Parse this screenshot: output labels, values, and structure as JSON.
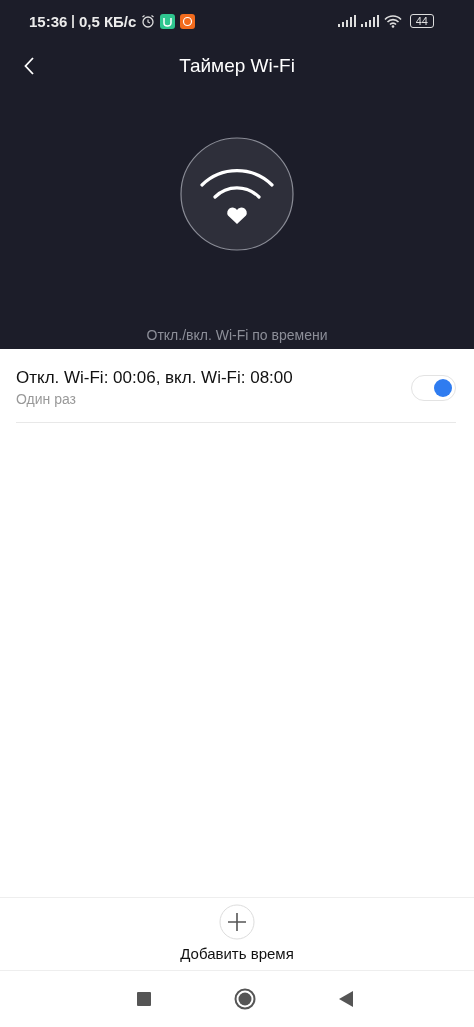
{
  "status_bar": {
    "time": "15:36",
    "speed": "0,5 КБ/с",
    "battery": "44"
  },
  "header": {
    "title": "Таймер Wi-Fi",
    "subtitle": "Откл./вкл. Wi-Fi по времени"
  },
  "timers": [
    {
      "title": "Откл. Wi-Fi: 00:06, вкл. Wi-Fi: 08:00",
      "repeat": "Один раз",
      "on": true
    }
  ],
  "add_button": {
    "label": "Добавить время"
  }
}
